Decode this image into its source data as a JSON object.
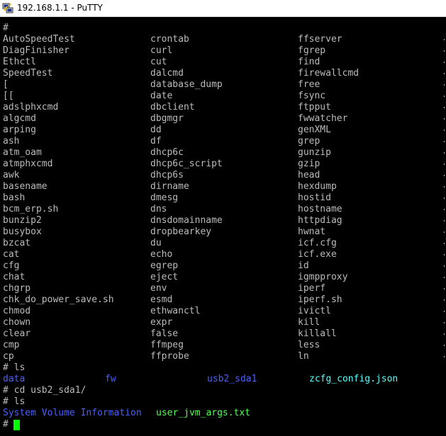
{
  "window": {
    "title": "192.168.1.1 - PuTTY"
  },
  "terminal": {
    "prompt_line_1": "#",
    "listing": [
      [
        "AutoSpeedTest",
        "crontab",
        "ffserver"
      ],
      [
        "DiagFinisher",
        "curl",
        "fgrep"
      ],
      [
        "Ethctl",
        "cut",
        "find"
      ],
      [
        "SpeedTest",
        "dalcmd",
        "firewallcmd"
      ],
      [
        "[",
        "database_dump",
        "free"
      ],
      [
        "[[",
        "date",
        "fsync"
      ],
      [
        "adslphxcmd",
        "dbclient",
        "ftpput"
      ],
      [
        "algcmd",
        "dbgmgr",
        "fwwatcher"
      ],
      [
        "arping",
        "dd",
        "genXML"
      ],
      [
        "ash",
        "df",
        "grep"
      ],
      [
        "atm_oam",
        "dhcp6c",
        "gunzip"
      ],
      [
        "atmphxcmd",
        "dhcp6c_script",
        "gzip"
      ],
      [
        "awk",
        "dhcp6s",
        "head"
      ],
      [
        "basename",
        "dirname",
        "hexdump"
      ],
      [
        "bash",
        "dmesg",
        "hostid"
      ],
      [
        "bcm_erp.sh",
        "dns",
        "hostname"
      ],
      [
        "bunzip2",
        "dnsdomainname",
        "httpdiag"
      ],
      [
        "busybox",
        "dropbearkey",
        "hwnat"
      ],
      [
        "bzcat",
        "du",
        "icf.cfg"
      ],
      [
        "cat",
        "echo",
        "icf.exe"
      ],
      [
        "cfg",
        "egrep",
        "id"
      ],
      [
        "chat",
        "eject",
        "igmpproxy"
      ],
      [
        "chgrp",
        "env",
        "iperf"
      ],
      [
        "chk_do_power_save.sh",
        "esmd",
        "iperf.sh"
      ],
      [
        "chmod",
        "ethwanctl",
        "ivictl"
      ],
      [
        "chown",
        "expr",
        "kill"
      ],
      [
        "clear",
        "false",
        "killall"
      ],
      [
        "cmp",
        "ffmpeg",
        "less"
      ],
      [
        "cp",
        "ffprobe",
        "ln"
      ]
    ],
    "cmd_ls_1": "# ls",
    "ls_1_entries": [
      {
        "name": "data",
        "color": "#4a60ff"
      },
      {
        "name": "fw",
        "color": "#4a60ff"
      },
      {
        "name": "usb2_sda1",
        "color": "#4a60ff"
      },
      {
        "name": "zcfg_config.json",
        "color": "#55ffff"
      }
    ],
    "cmd_cd": "# cd usb2_sda1/",
    "cmd_ls_2": "# ls",
    "ls_2_entries": [
      {
        "name": "System Volume Information",
        "color": "#4a60ff"
      },
      {
        "name": "user_jvm_args.txt",
        "color": "#55ff55"
      }
    ],
    "final_prompt": "#",
    "cursor_color": "#00ff00",
    "text_color": "#bbbbbb",
    "background_color": "#000000"
  }
}
